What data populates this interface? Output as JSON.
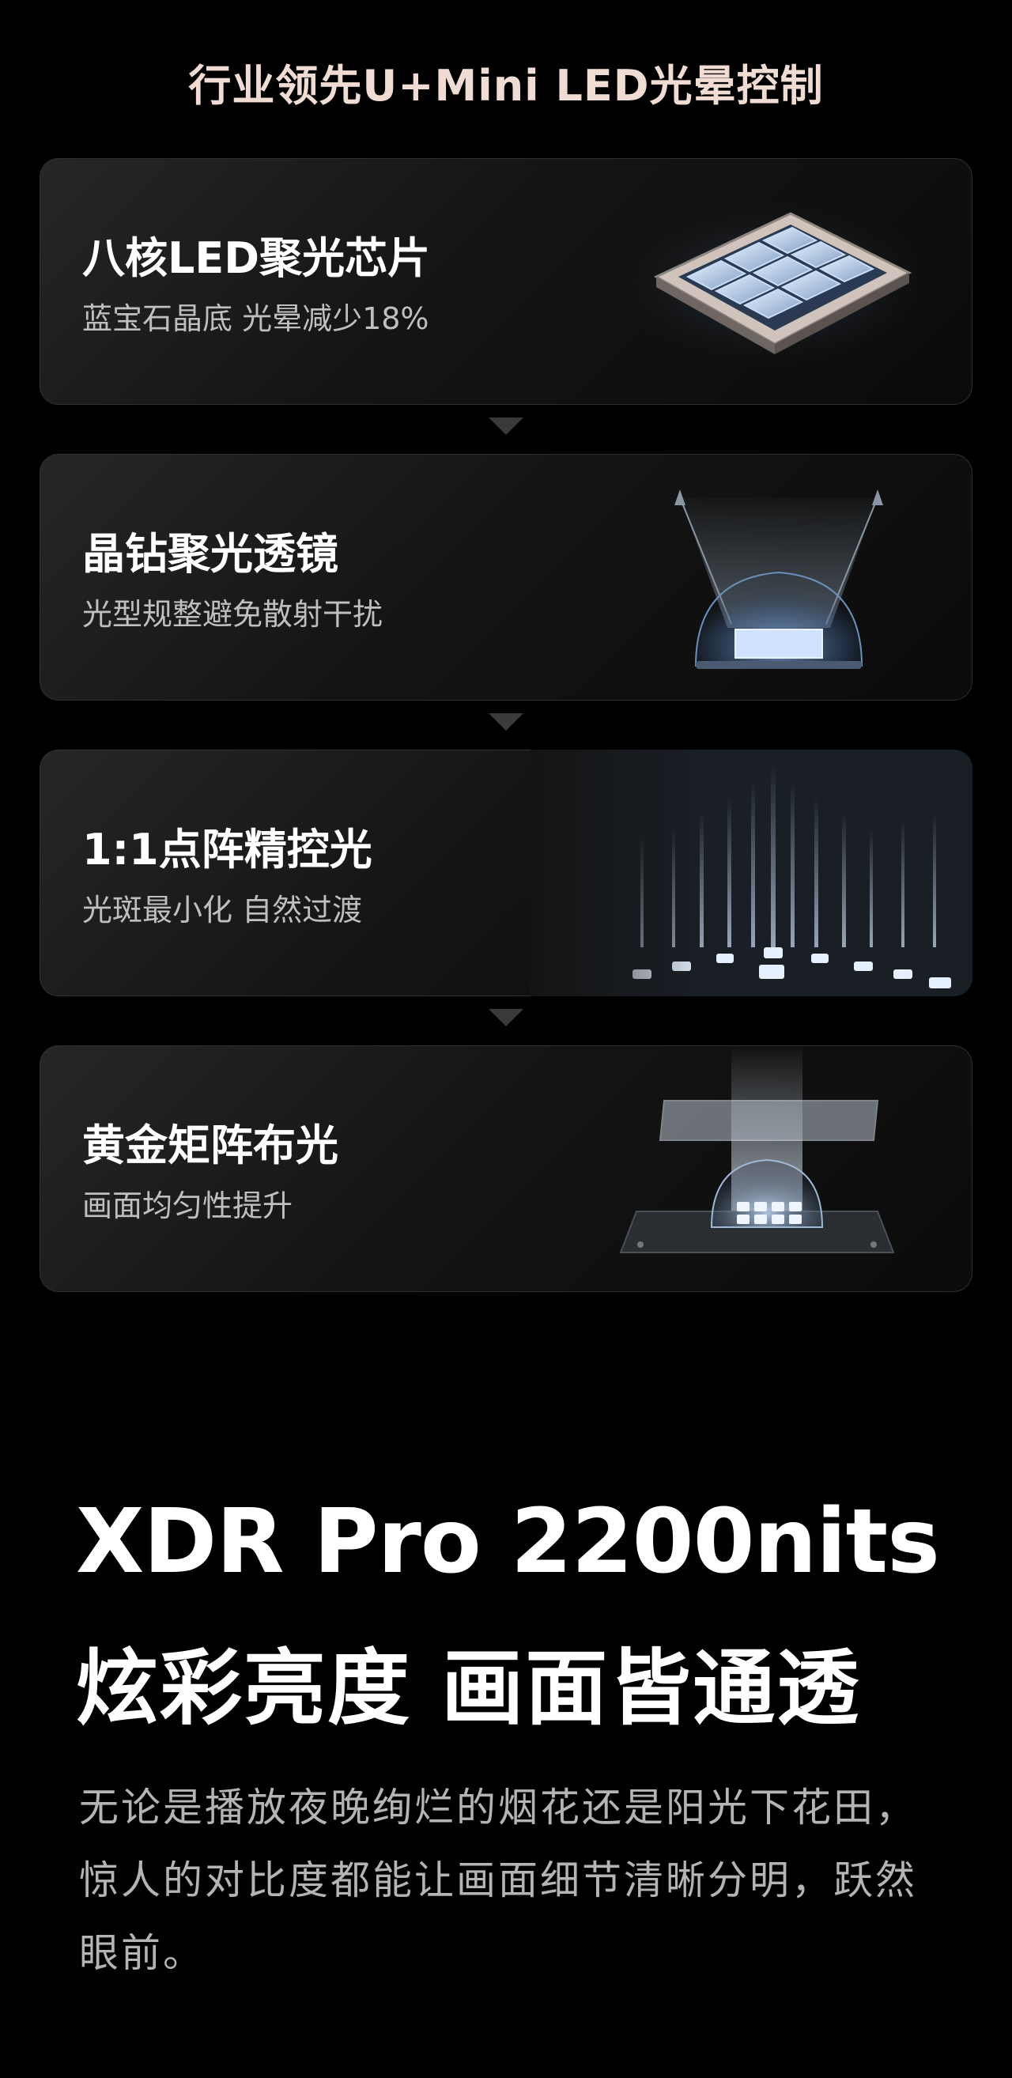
{
  "section_title": "行业领先U+Mini LED光晕控制",
  "cards": [
    {
      "title": "八核LED聚光芯片",
      "subtitle": "蓝宝石晶底 光晕减少18%",
      "art_icon": "led-chip-icon"
    },
    {
      "title": "晶钻聚光透镜",
      "subtitle": "光型规整避免散射干扰",
      "art_icon": "lens-dome-icon"
    },
    {
      "title": "1:1点阵精控光",
      "subtitle": "光斑最小化 自然过渡",
      "art_icon": "led-array-icon"
    },
    {
      "title": "黄金矩阵布光",
      "subtitle": "画面均匀性提升",
      "art_icon": "light-matrix-icon"
    }
  ],
  "headline": {
    "line1": "XDR Pro 2200nits",
    "line2": "炫彩亮度 画面皆通透"
  },
  "description": "无论是播放夜晚绚烂的烟花还是阳光下花田，惊人的对比度都能让画面细节清晰分明，跃然眼前。",
  "colors": {
    "background": "#000000",
    "title_accent": "#f0dcd2",
    "card_bg": "#161616",
    "subtitle_text": "#bfbfbf",
    "body_text": "#b4b4b4"
  }
}
